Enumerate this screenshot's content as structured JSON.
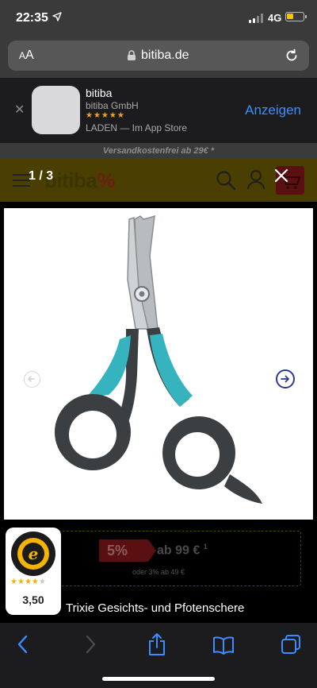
{
  "status_bar": {
    "time": "22:35",
    "network": "4G"
  },
  "url_bar": {
    "text_size_label": "AA",
    "domain": "bitiba.de"
  },
  "app_banner": {
    "app_name": "bitiba",
    "developer": "bitiba GmbH",
    "rating_stars": "★★★★★",
    "store_text": "LADEN — Im App Store",
    "open_label": "Anzeigen"
  },
  "page": {
    "shipping_notice": "Versandkostenfrei ab 29€ *",
    "logo_text": "bitiba",
    "logo_suffix": "%",
    "promo": {
      "discount": "5%",
      "price": "ab 99 €",
      "price_footnote": "1",
      "sub": "oder 3% ab 49 €"
    }
  },
  "gallery": {
    "counter": "1 / 3",
    "image_alt": "Trixie Gesichts- und Pfotenschere",
    "caption": "Trixie Gesichts- und Pfotenschere"
  },
  "trusted_shops": {
    "rating": "3,50",
    "stars_filled": 3.5,
    "stars_total": 5
  },
  "colors": {
    "accent_blue": "#3d8dff",
    "nav_arrow": "#2c3a8c",
    "scissor_teal": "#35b4c0",
    "scissor_handle": "#3c3f41"
  },
  "icons": {
    "back": "chevron-left-icon",
    "forward": "chevron-right-icon",
    "share": "share-icon",
    "bookmarks": "book-icon",
    "tabs": "tabs-icon"
  }
}
